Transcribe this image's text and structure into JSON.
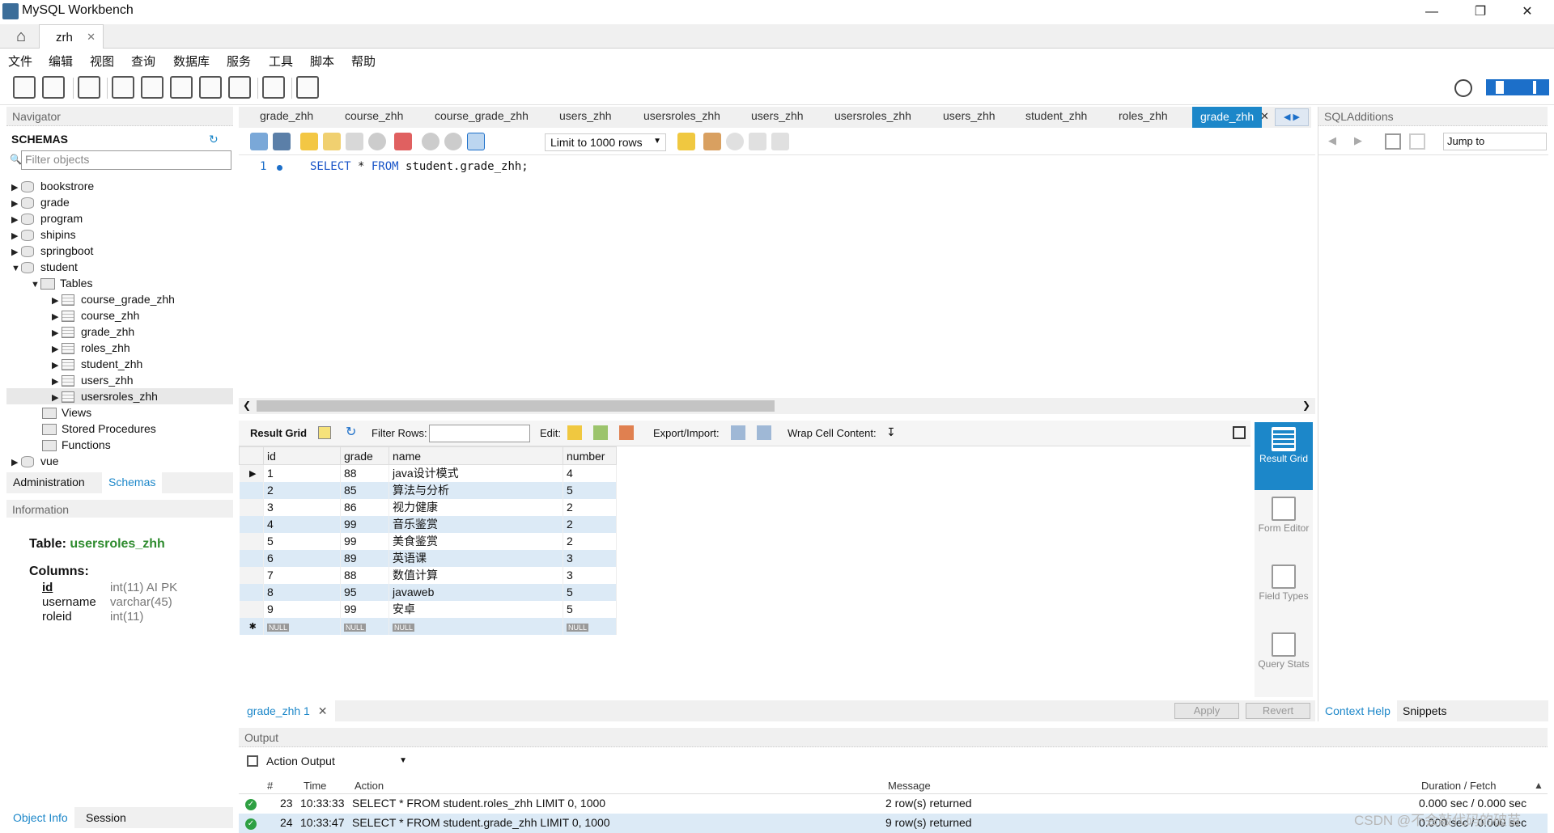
{
  "app": {
    "title": "MySQL Workbench"
  },
  "conn_tab": {
    "label": "zrh"
  },
  "menu": [
    "文件",
    "编辑",
    "视图",
    "查询",
    "数据库",
    "服务",
    "工具",
    "脚本",
    "帮助"
  ],
  "navigator": {
    "header": "Navigator",
    "schemas_label": "SCHEMAS",
    "filter_placeholder": "Filter objects",
    "schemas": [
      "bookstrore",
      "grade",
      "program",
      "shipins",
      "springboot",
      "student"
    ],
    "tables_label": "Tables",
    "tables": [
      "course_grade_zhh",
      "course_zhh",
      "grade_zhh",
      "roles_zhh",
      "student_zhh",
      "users_zhh",
      "usersroles_zhh"
    ],
    "views_label": "Views",
    "procedures_label": "Stored Procedures",
    "functions_label": "Functions",
    "last_schema": "vue",
    "tab_admin": "Administration",
    "tab_schemas": "Schemas"
  },
  "information": {
    "header": "Information",
    "table_prefix": "Table:",
    "table_name": "usersroles_zhh",
    "columns_label": "Columns:",
    "columns": [
      {
        "name": "id",
        "type": "int(11) AI PK"
      },
      {
        "name": "username",
        "type": "varchar(45)"
      },
      {
        "name": "roleid",
        "type": "int(11)"
      }
    ],
    "tab_object": "Object Info",
    "tab_session": "Session"
  },
  "editor_tabs": [
    "grade_zhh",
    "course_zhh",
    "course_grade_zhh",
    "users_zhh",
    "usersroles_zhh",
    "users_zhh",
    "usersroles_zhh",
    "users_zhh",
    "student_zhh",
    "roles_zhh",
    "grade_zhh"
  ],
  "editor": {
    "limit": "Limit to 1000 rows",
    "line_no": "1",
    "sql_kw1": "SELECT",
    "sql_star": " * ",
    "sql_kw2": "FROM",
    "sql_rest": " student.grade_zhh;"
  },
  "result_toolbar": {
    "result_grid": "Result Grid",
    "filter_rows": "Filter Rows:",
    "edit": "Edit:",
    "export": "Export/Import:",
    "wrap": "Wrap Cell Content:"
  },
  "grid": {
    "columns": [
      "id",
      "grade",
      "name",
      "number"
    ],
    "rows": [
      [
        "1",
        "88",
        "java设计模式",
        "4"
      ],
      [
        "2",
        "85",
        "算法与分析",
        "5"
      ],
      [
        "3",
        "86",
        "视力健康",
        "2"
      ],
      [
        "4",
        "99",
        "音乐鉴赏",
        "2"
      ],
      [
        "5",
        "99",
        "美食鉴赏",
        "2"
      ],
      [
        "6",
        "89",
        "英语课",
        "3"
      ],
      [
        "7",
        "88",
        "数值计算",
        "3"
      ],
      [
        "8",
        "95",
        "javaweb",
        "5"
      ],
      [
        "9",
        "99",
        "安卓",
        "5"
      ]
    ],
    "null_label": "NULL"
  },
  "side_buttons": [
    {
      "label": "Result Grid"
    },
    {
      "label": "Form Editor"
    },
    {
      "label": "Field Types"
    },
    {
      "label": "Query Stats"
    }
  ],
  "result_footer": {
    "tab": "grade_zhh 1",
    "apply": "Apply",
    "revert": "Revert"
  },
  "sql_additions": {
    "header": "SQLAdditions",
    "jump": "Jump to",
    "context_help": "Context Help",
    "snippets": "Snippets"
  },
  "output": {
    "header": "Output",
    "select": "Action Output",
    "cols": [
      "#",
      "Time",
      "Action",
      "Message",
      "Duration / Fetch"
    ],
    "rows": [
      {
        "n": "23",
        "time": "10:33:33",
        "action": "SELECT * FROM student.roles_zhh LIMIT 0, 1000",
        "msg": "2 row(s) returned",
        "dur": "0.000 sec / 0.000 sec"
      },
      {
        "n": "24",
        "time": "10:33:47",
        "action": "SELECT * FROM student.grade_zhh LIMIT 0, 1000",
        "msg": "9 row(s) returned",
        "dur": "0.000 sec / 0.000 sec"
      }
    ]
  },
  "watermark": "CSDN @不会敲代码的破苗",
  "colors": {
    "accent": "#1c87c9",
    "row_alt": "#dceaf6",
    "success": "#2ea043"
  }
}
